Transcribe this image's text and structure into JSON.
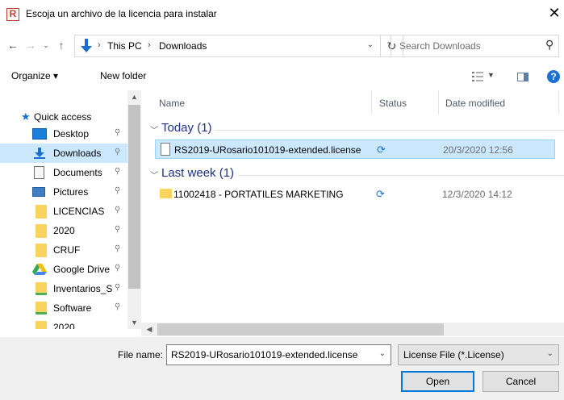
{
  "window": {
    "title": "Escoja un archivo de la licencia para instalar",
    "app_icon_letter": "R",
    "close_glyph": "✕"
  },
  "address": {
    "segments": [
      "This PC",
      "Downloads"
    ],
    "separator": "›",
    "refresh_glyph": "↻",
    "search_placeholder": "Search Downloads"
  },
  "toolbar": {
    "organize_label": "Organize ▾",
    "new_folder_label": "New folder",
    "help_glyph": "?"
  },
  "navpane": {
    "quick_access_label": "Quick access",
    "items": [
      {
        "label": "Desktop",
        "icon": "desktop-icon"
      },
      {
        "label": "Downloads",
        "icon": "downloads-icon",
        "selected": true
      },
      {
        "label": "Documents",
        "icon": "documents-icon"
      },
      {
        "label": "Pictures",
        "icon": "pictures-icon"
      },
      {
        "label": "LICENCIAS",
        "icon": "folder-icon"
      },
      {
        "label": "2020",
        "icon": "folder-icon"
      },
      {
        "label": "CRUF",
        "icon": "folder-icon"
      },
      {
        "label": "Google Drive",
        "icon": "google-drive-icon"
      },
      {
        "label": "Inventarios_S",
        "icon": "folder-icon"
      },
      {
        "label": "Software",
        "icon": "folder-icon"
      },
      {
        "label": "2020",
        "icon": "folder-icon"
      }
    ],
    "pin_glyph": "📌"
  },
  "filelist": {
    "columns": {
      "name": "Name",
      "status": "Status",
      "date": "Date modified"
    },
    "groups": [
      {
        "label": "Today (1)",
        "files": [
          {
            "name": "RS2019-URosario101019-extended.license",
            "date": "20/3/2020 12:56",
            "type": "document",
            "selected": true
          }
        ]
      },
      {
        "label": "Last week (1)",
        "files": [
          {
            "name": "11002418 - PORTATILES MARKETING",
            "date": "12/3/2020 14:12",
            "type": "folder",
            "selected": false
          }
        ]
      }
    ],
    "sync_glyph": "⟳"
  },
  "bottom": {
    "file_name_label": "File name:",
    "file_name_value": "RS2019-URosario101019-extended.license",
    "filter_value": "License File (*.License)",
    "open_label": "Open",
    "cancel_label": "Cancel"
  },
  "colors": {
    "selection": "#cce8ff",
    "accent": "#0078d7",
    "group_header": "#1e3287",
    "folder": "#f8d35e"
  }
}
